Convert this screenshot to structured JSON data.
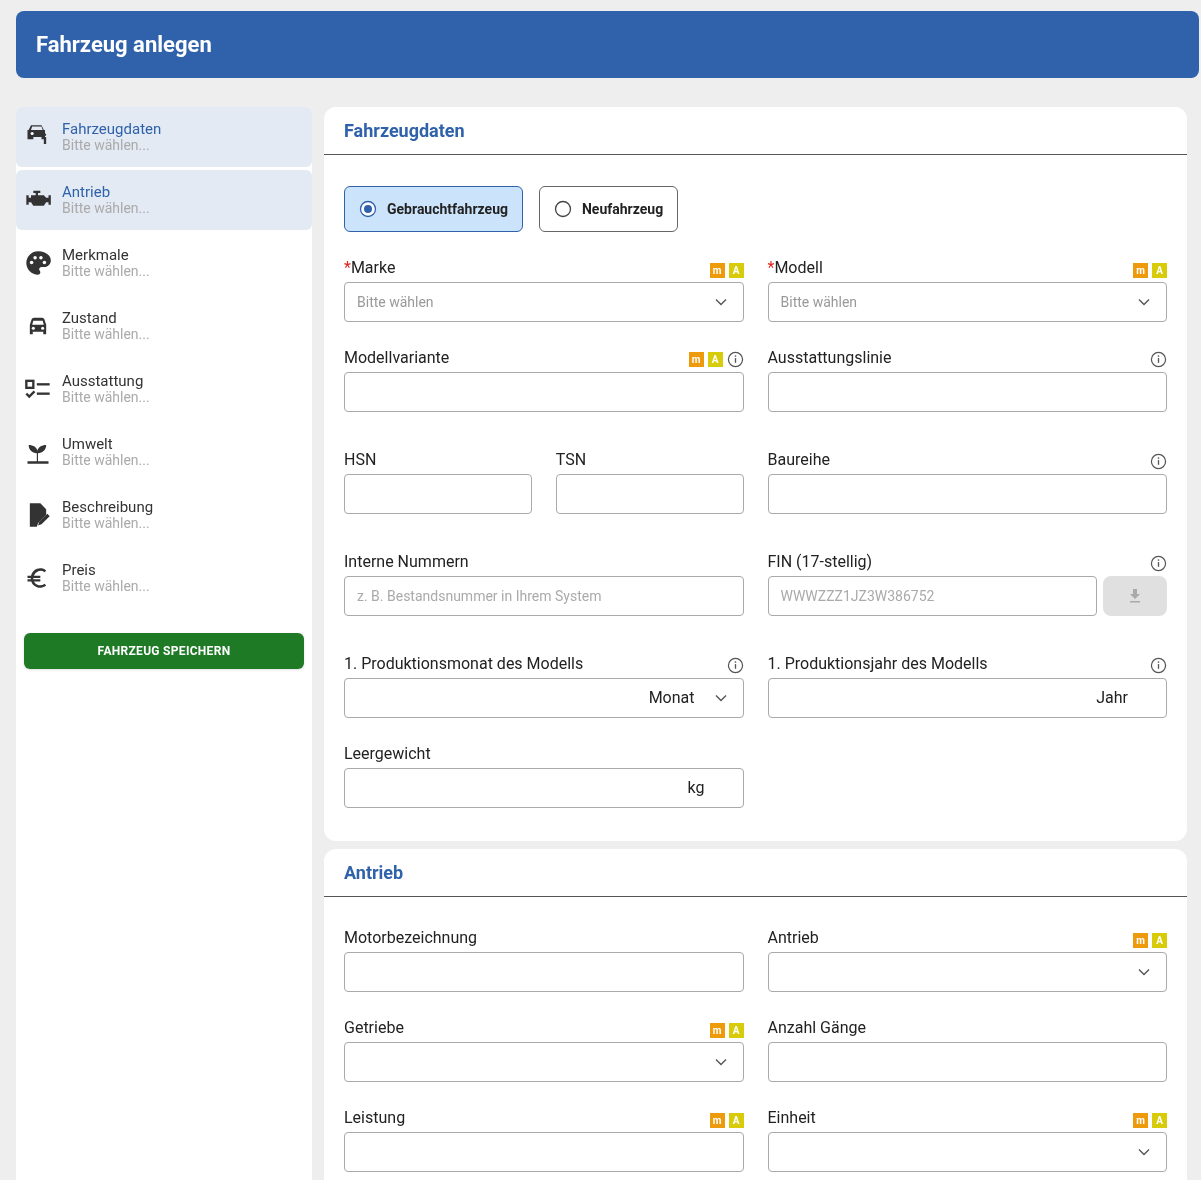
{
  "header": {
    "title": "Fahrzeug anlegen"
  },
  "sidebar": {
    "items": [
      {
        "label": "Fahrzeugdaten",
        "subtitle": "Bitte wählen...",
        "selected": true
      },
      {
        "label": "Antrieb",
        "subtitle": "Bitte wählen...",
        "selected": true
      },
      {
        "label": "Merkmale",
        "subtitle": "Bitte wählen...",
        "selected": false
      },
      {
        "label": "Zustand",
        "subtitle": "Bitte wählen...",
        "selected": false
      },
      {
        "label": "Ausstattung",
        "subtitle": "Bitte wählen...",
        "selected": false
      },
      {
        "label": "Umwelt",
        "subtitle": "Bitte wählen...",
        "selected": false
      },
      {
        "label": "Beschreibung",
        "subtitle": "Bitte wählen...",
        "selected": false
      },
      {
        "label": "Preis",
        "subtitle": "Bitte wählen...",
        "selected": false
      }
    ],
    "save_button": "FAHRZEUG SPEICHERN"
  },
  "sections": [
    {
      "title": "Fahrzeugdaten",
      "radio_options": [
        {
          "label": "Gebrauchtfahrzeug",
          "selected": true
        },
        {
          "label": "Neufahrzeug",
          "selected": false
        }
      ],
      "rows": [
        {
          "left": [
            {
              "label": "Marke",
              "required_mark": "*",
              "badges": [
                "m",
                "A"
              ],
              "info": false,
              "kind": "select",
              "placeholder": "Bitte wählen"
            }
          ],
          "right": [
            {
              "label": "Modell",
              "required_mark": "*",
              "badges": [
                "m",
                "A"
              ],
              "info": false,
              "kind": "select",
              "placeholder": "Bitte wählen"
            }
          ]
        },
        {
          "left": [
            {
              "label": "Modellvariante",
              "badges": [
                "m",
                "A"
              ],
              "info": true,
              "kind": "input"
            }
          ],
          "right": [
            {
              "label": "Ausstattungslinie",
              "info": true,
              "kind": "input"
            }
          ]
        },
        {
          "left": [
            {
              "label": "HSN",
              "info": false,
              "kind": "input"
            },
            {
              "label": "TSN",
              "info": false,
              "kind": "input"
            }
          ],
          "right": [
            {
              "label": "Baureihe",
              "info": true,
              "kind": "input"
            }
          ]
        },
        {
          "left": [
            {
              "label": "Interne Nummern",
              "info": false,
              "kind": "input",
              "placeholder": "z. B. Bestandsnummer in Ihrem System"
            }
          ],
          "right": [
            {
              "label": "FIN (17-stellig)",
              "info": true,
              "kind": "fin",
              "placeholder": "WWWZZZ1JZ3W386752"
            }
          ]
        },
        {
          "left": [
            {
              "label": "1. Produktionsmonat des Modells",
              "info": true,
              "kind": "unit_select",
              "unit": "Monat"
            }
          ],
          "right": [
            {
              "label": "1. Produktionsjahr des Modells",
              "info": true,
              "kind": "unit",
              "unit": "Jahr"
            }
          ]
        },
        {
          "left": [
            {
              "label": "Leergewicht",
              "info": false,
              "kind": "unit",
              "unit": "kg"
            }
          ],
          "right": []
        }
      ]
    },
    {
      "title": "Antrieb",
      "rows": [
        {
          "left": [
            {
              "label": "Motorbezeichnung",
              "info": false,
              "kind": "input"
            }
          ],
          "right": [
            {
              "label": "Antrieb",
              "badges": [
                "m",
                "A"
              ],
              "info": false,
              "kind": "select"
            }
          ]
        },
        {
          "left": [
            {
              "label": "Getriebe",
              "badges": [
                "m",
                "A"
              ],
              "info": false,
              "kind": "select"
            }
          ],
          "right": [
            {
              "label": "Anzahl Gänge",
              "info": false,
              "kind": "input"
            }
          ]
        },
        {
          "left": [
            {
              "label": "Leistung",
              "badges": [
                "m",
                "A"
              ],
              "info": false,
              "kind": "input"
            }
          ],
          "right": [
            {
              "label": "Einheit",
              "badges": [
                "m",
                "A"
              ],
              "info": false,
              "kind": "select"
            }
          ]
        }
      ]
    }
  ]
}
